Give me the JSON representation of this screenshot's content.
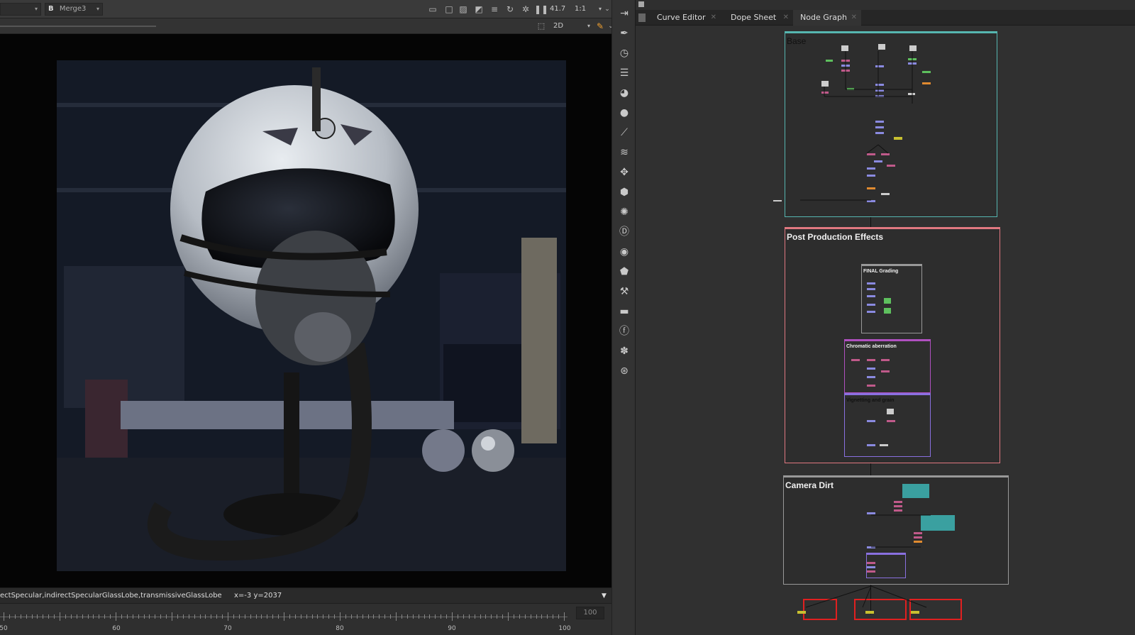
{
  "viewer": {
    "input_a": "",
    "input_b_label": "B",
    "input_b": "Merge3",
    "zoom": "41.7",
    "ratio": "1:1",
    "view_mode": "2D",
    "status_channels": "ectSpecular,indirectSpecularGlassLobe,transmissiveGlassLobe",
    "status_coords": "x=-3 y=2037",
    "end_frame": "100"
  },
  "timeline": {
    "tick_labels": [
      "50",
      "60",
      "70",
      "80",
      "90",
      "100"
    ]
  },
  "node_graph": {
    "tabs": [
      {
        "label": "Curve Editor"
      },
      {
        "label": "Dope Sheet"
      },
      {
        "label": "Node Graph"
      }
    ],
    "backdrops": {
      "base": "Base",
      "post": "Post Production Effects",
      "final_grading": "FINAL Grading",
      "chromatic": "Chromatic aberration",
      "vignetting": "Vignetting and grain",
      "camera_dirt": "Camera Dirt"
    }
  },
  "colors": {
    "accent_orange": "#f0a030",
    "base_backdrop": "#56b6b0",
    "post_backdrop": "#e07880",
    "chromatic_backdrop": "#b050c0",
    "vignetting_backdrop": "#8a70e0",
    "write_nodes": "#e02020"
  },
  "icons": [
    "panel-menu-icon",
    "roto-pen-icon",
    "timer-icon",
    "channel-icon",
    "color-wheel-icon",
    "circle-icon",
    "filter-icon",
    "layers-icon",
    "transform-icon",
    "3d-cube-icon",
    "particles-icon",
    "deep-icon",
    "views-icon",
    "metadata-icon",
    "toolsets-icon",
    "other-icon",
    "furnace-icon",
    "nukex-icon",
    "cara-icon"
  ]
}
